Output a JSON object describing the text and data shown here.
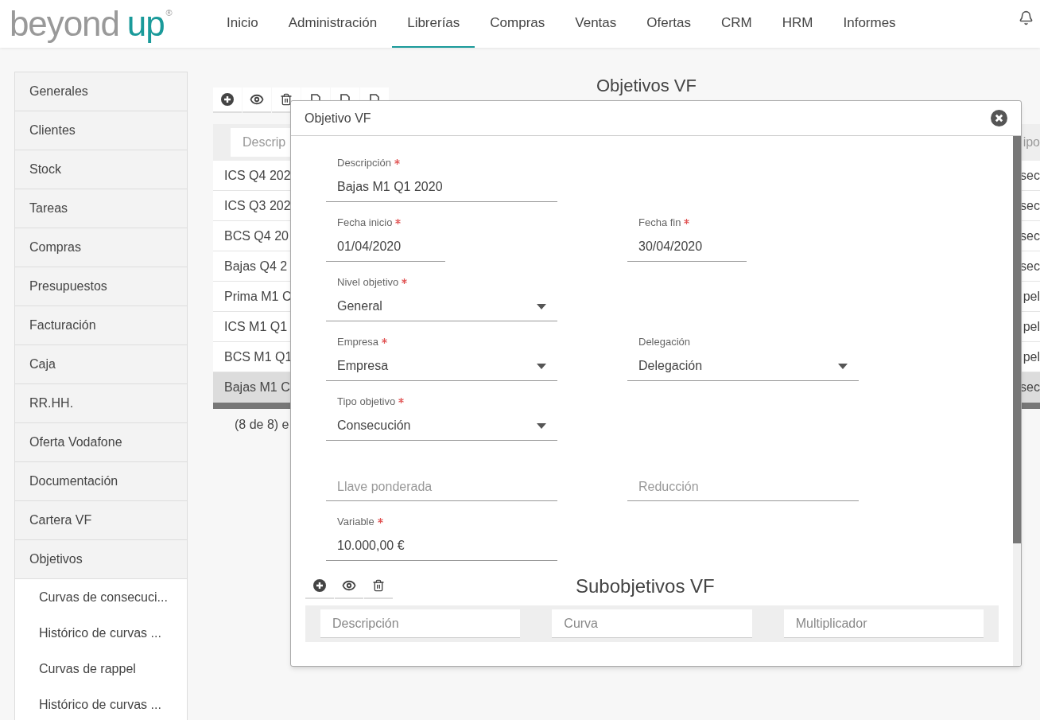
{
  "logo": {
    "text": "beyond",
    "accent": "up",
    "mark": "®"
  },
  "nav": [
    {
      "label": "Inicio",
      "selected": false
    },
    {
      "label": "Administración",
      "selected": false
    },
    {
      "label": "Librerías",
      "selected": true
    },
    {
      "label": "Compras",
      "selected": false
    },
    {
      "label": "Ventas",
      "selected": false
    },
    {
      "label": "Ofertas",
      "selected": false
    },
    {
      "label": "CRM",
      "selected": false
    },
    {
      "label": "HRM",
      "selected": false
    },
    {
      "label": "Informes",
      "selected": false
    }
  ],
  "sidebar": {
    "items": [
      {
        "label": "Generales"
      },
      {
        "label": "Clientes"
      },
      {
        "label": "Stock"
      },
      {
        "label": "Tareas"
      },
      {
        "label": "Compras"
      },
      {
        "label": "Presupuestos"
      },
      {
        "label": "Facturación"
      },
      {
        "label": "Caja"
      },
      {
        "label": "RR.HH."
      },
      {
        "label": "Oferta Vodafone"
      },
      {
        "label": "Documentación"
      },
      {
        "label": "Cartera VF"
      },
      {
        "label": "Objetivos",
        "children": [
          {
            "label": "Curvas de consecuci..."
          },
          {
            "label": "Histórico de curvas ..."
          },
          {
            "label": "Curvas de rappel"
          },
          {
            "label": "Histórico de curvas ..."
          }
        ]
      }
    ]
  },
  "page_title": "Objetivos VF",
  "toolbar": [
    {
      "kind": "add"
    },
    {
      "kind": "view"
    },
    {
      "kind": "delete"
    },
    {
      "kind": "other"
    },
    {
      "kind": "other"
    },
    {
      "kind": "other"
    }
  ],
  "table": {
    "filter_placeholder": "Descrip",
    "last_header": "ipo",
    "rows": [
      {
        "column_1": "ICS Q4 202",
        "column_last": "sec",
        "selected": false
      },
      {
        "column_1": "ICS Q3 202",
        "column_last": "sec",
        "selected": false
      },
      {
        "column_1": "BCS Q4 20",
        "column_last": "sec",
        "selected": false
      },
      {
        "column_1": "Bajas Q4 2",
        "column_last": "sec",
        "selected": false
      },
      {
        "column_1": "Prima M1 C",
        "column_last": "pel",
        "selected": false
      },
      {
        "column_1": "ICS M1 Q1",
        "column_last": "pel",
        "selected": false
      },
      {
        "column_1": "BCS M1 Q1",
        "column_last": "pel",
        "selected": false
      },
      {
        "column_1": "Bajas M1 C",
        "column_last": "sec",
        "selected": true
      }
    ],
    "footer": "(8 de 8) e"
  },
  "dialog": {
    "title": "Objetivo VF",
    "rows": [
      [
        {
          "kind": "text",
          "label": "Descripción",
          "required": true,
          "value": "Bajas M1 Q1 2020"
        }
      ],
      [
        {
          "kind": "date",
          "label": "Fecha inicio",
          "required": true,
          "value": "01/04/2020"
        },
        {
          "kind": "date",
          "label": "Fecha fin",
          "required": true,
          "value": "30/04/2020"
        }
      ],
      [
        {
          "kind": "select",
          "label": "Nivel objetivo",
          "required": true,
          "value": "General"
        }
      ],
      [
        {
          "kind": "select",
          "label": "Empresa",
          "required": true,
          "value": "Empresa"
        },
        {
          "kind": "select",
          "label": "Delegación",
          "required": false,
          "value": "Delegación"
        }
      ],
      [
        {
          "kind": "select",
          "label": "Tipo objetivo",
          "required": true,
          "value": "Consecución"
        }
      ],
      [
        {
          "kind": "text",
          "placeholder": "Llave ponderada"
        },
        {
          "kind": "text",
          "placeholder": "Reducción"
        }
      ],
      [
        {
          "kind": "text",
          "label": "Variable",
          "required": true,
          "value": "10.000,00 €"
        }
      ]
    ],
    "sub": {
      "title": "Subobjetivos VF",
      "toolbar": [
        {
          "kind": "add"
        },
        {
          "kind": "view"
        },
        {
          "kind": "delete"
        }
      ],
      "filters": [
        "Descripción",
        "Curva",
        "Multiplicador"
      ]
    }
  }
}
